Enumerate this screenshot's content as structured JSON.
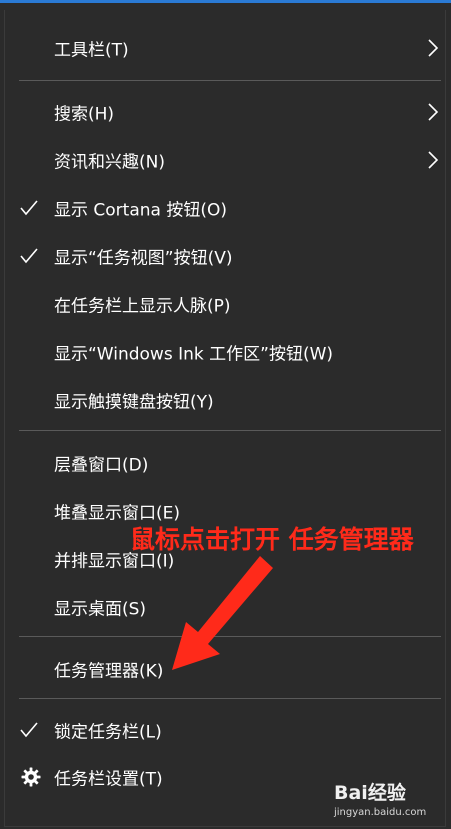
{
  "menu": {
    "items": [
      {
        "label": "工具栏(T)",
        "checked": false,
        "submenu": true
      },
      {
        "label": "搜索(H)",
        "checked": false,
        "submenu": true
      },
      {
        "label": "资讯和兴趣(N)",
        "checked": false,
        "submenu": true
      },
      {
        "label": "显示 Cortana 按钮(O)",
        "checked": true,
        "submenu": false
      },
      {
        "label": "显示“任务视图”按钮(V)",
        "checked": true,
        "submenu": false
      },
      {
        "label": "在任务栏上显示人脉(P)",
        "checked": false,
        "submenu": false
      },
      {
        "label": "显示“Windows Ink 工作区”按钮(W)",
        "checked": false,
        "submenu": false
      },
      {
        "label": "显示触摸键盘按钮(Y)",
        "checked": false,
        "submenu": false
      },
      {
        "label": "层叠窗口(D)",
        "checked": false,
        "submenu": false
      },
      {
        "label": "堆叠显示窗口(E)",
        "checked": false,
        "submenu": false
      },
      {
        "label": "并排显示窗口(I)",
        "checked": false,
        "submenu": false
      },
      {
        "label": "显示桌面(S)",
        "checked": false,
        "submenu": false
      },
      {
        "label": "任务管理器(K)",
        "checked": false,
        "submenu": false
      },
      {
        "label": "锁定任务栏(L)",
        "checked": true,
        "submenu": false
      },
      {
        "label": "任务栏设置(T)",
        "checked": false,
        "submenu": false,
        "icon": "gear-icon"
      }
    ]
  },
  "annotation": {
    "text": "鼠标点击打开 任务管理器",
    "color": "#ff2a1a"
  },
  "watermark": {
    "main": "Bai经验",
    "sub": "jingyan.baidu.com"
  },
  "colors": {
    "menu_bg": "#2b2b2b",
    "text": "#ffffff",
    "separator": "#5a5a5a",
    "accent": "#2a7ad5"
  }
}
